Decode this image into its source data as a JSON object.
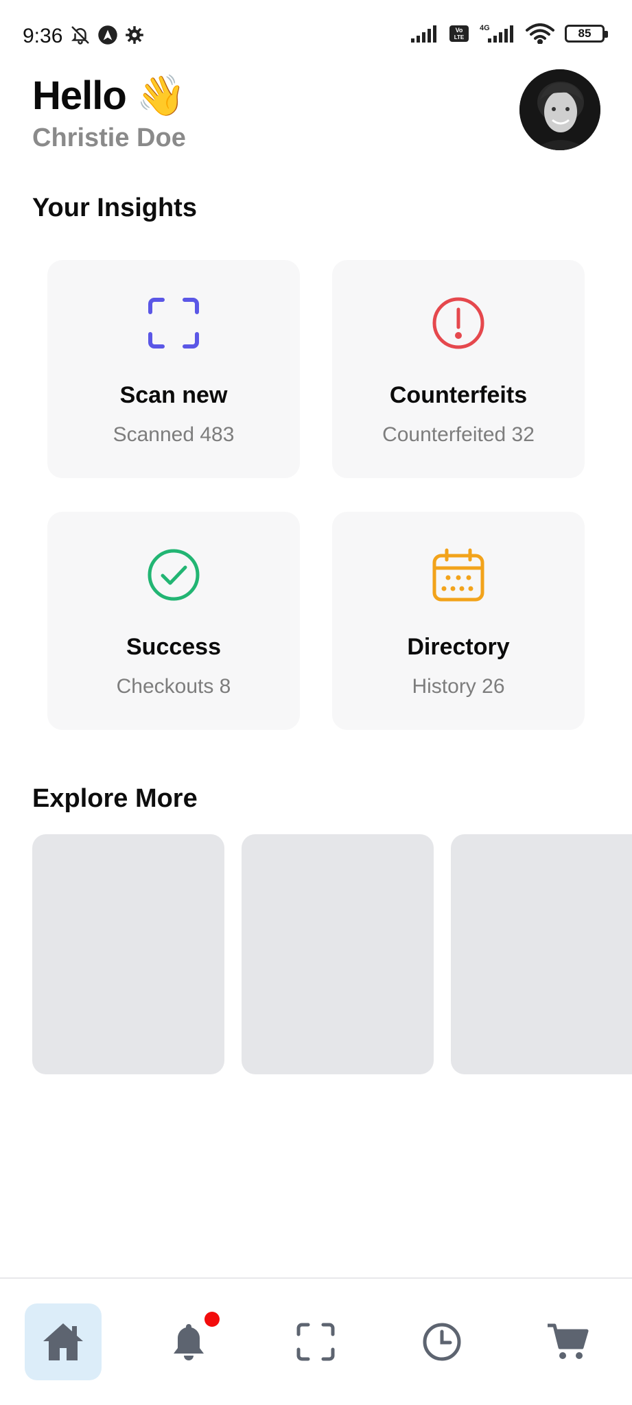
{
  "status_bar": {
    "time": "9:36",
    "battery_level": "85",
    "network_label": "4G",
    "volte_label": "Vo LTE"
  },
  "header": {
    "greeting": "Hello 👋",
    "user_name": "Christie Doe"
  },
  "insights": {
    "title": "Your Insights",
    "cards": [
      {
        "title": "Scan new",
        "subtitle": "Scanned 483",
        "icon": "scan-frame-icon",
        "color": "#5b57e6"
      },
      {
        "title": "Counterfeits",
        "subtitle": "Counterfeited 32",
        "icon": "alert-circle-icon",
        "color": "#e5484d"
      },
      {
        "title": "Success",
        "subtitle": "Checkouts 8",
        "icon": "check-circle-icon",
        "color": "#22b573"
      },
      {
        "title": "Directory",
        "subtitle": "History 26",
        "icon": "calendar-icon",
        "color": "#f2a31b"
      }
    ]
  },
  "explore": {
    "title": "Explore More",
    "cards": 3
  },
  "bottom_nav": {
    "items": [
      {
        "name": "home",
        "icon": "home-icon",
        "active": true
      },
      {
        "name": "notifications",
        "icon": "bell-icon",
        "badge": true
      },
      {
        "name": "scan",
        "icon": "scan-frame-icon"
      },
      {
        "name": "history",
        "icon": "clock-icon"
      },
      {
        "name": "cart",
        "icon": "cart-icon"
      }
    ],
    "active_color": "#dcedf9",
    "badge_color": "#f20c0c"
  }
}
